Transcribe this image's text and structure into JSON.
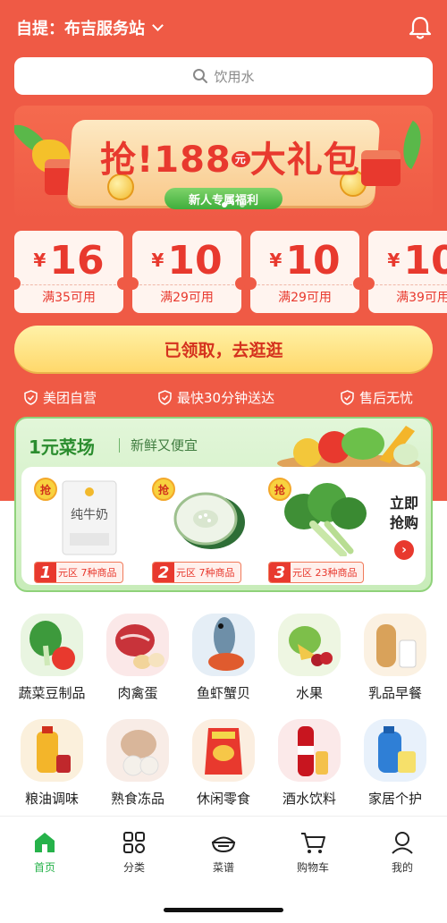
{
  "header": {
    "pickup_label": "自提：布吉服务站"
  },
  "search": {
    "placeholder": "饮用水"
  },
  "banner": {
    "headline_prefix": "抢!188",
    "yuan_mark": "元",
    "headline_suffix": "大礼包",
    "pill": "新人专属福利",
    "active_dot": 0
  },
  "coupons": [
    {
      "currency": "¥",
      "amount": "16",
      "condition": "满35可用"
    },
    {
      "currency": "¥",
      "amount": "10",
      "condition": "满29可用"
    },
    {
      "currency": "¥",
      "amount": "10",
      "condition": "满29可用"
    },
    {
      "currency": "¥",
      "amount": "10",
      "condition": "满39可用"
    }
  ],
  "claim_button": "已领取，去逛逛",
  "guarantees": [
    "美团自营",
    "最快30分钟送达",
    "售后无忧"
  ],
  "market": {
    "title": "1元菜场",
    "subtitle": "新鲜又便宜",
    "badge": "抢",
    "products": [
      {
        "num": "1",
        "zone": "元区 7种商品",
        "pack_text": "纯牛奶"
      },
      {
        "num": "2",
        "zone": "元区 7种商品"
      },
      {
        "num": "3",
        "zone": "元区 23种商品"
      }
    ],
    "cta_line1": "立即",
    "cta_line2": "抢购",
    "cta_arrow": "›"
  },
  "categories": [
    {
      "label": "蔬菜豆制品",
      "icon": "vegetable-icon"
    },
    {
      "label": "肉禽蛋",
      "icon": "meat-icon"
    },
    {
      "label": "鱼虾蟹贝",
      "icon": "seafood-icon"
    },
    {
      "label": "水果",
      "icon": "fruit-icon"
    },
    {
      "label": "乳品早餐",
      "icon": "dairy-icon"
    },
    {
      "label": "粮油调味",
      "icon": "oil-icon"
    },
    {
      "label": "熟食冻品",
      "icon": "frozen-food-icon"
    },
    {
      "label": "休闲零食",
      "icon": "snack-icon"
    },
    {
      "label": "酒水饮料",
      "icon": "drink-icon"
    },
    {
      "label": "家居个护",
      "icon": "household-icon"
    }
  ],
  "nav": {
    "tabs": [
      {
        "label": "首页",
        "icon": "home-icon",
        "active": true
      },
      {
        "label": "分类",
        "icon": "category-grid-icon",
        "active": false
      },
      {
        "label": "菜谱",
        "icon": "recipe-bowl-icon",
        "active": false
      },
      {
        "label": "购物车",
        "icon": "cart-icon",
        "active": false
      },
      {
        "label": "我的",
        "icon": "profile-icon",
        "active": false
      }
    ]
  },
  "colors": {
    "brand_red": "#ef5a45",
    "accent_red": "#e8392e",
    "claim_yellow": "#ffd86b",
    "market_green": "#2b8d2f",
    "nav_active": "#26b24a"
  }
}
